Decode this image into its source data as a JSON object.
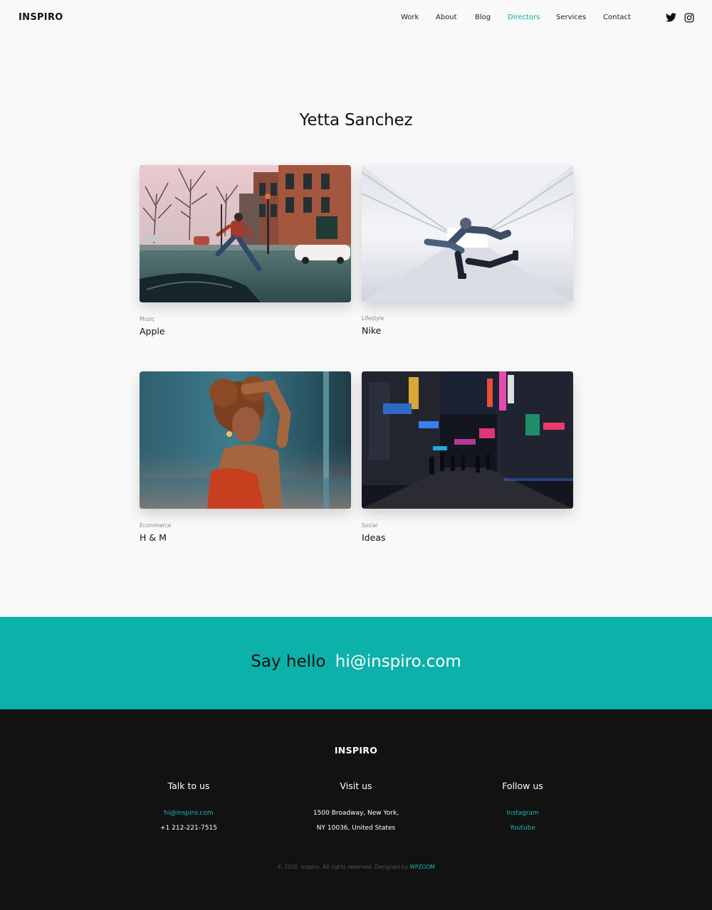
{
  "header": {
    "logo": "INSPIRO",
    "nav": [
      {
        "label": "Work",
        "active": false
      },
      {
        "label": "About",
        "active": false
      },
      {
        "label": "Blog",
        "active": false
      },
      {
        "label": "Directors",
        "active": true
      },
      {
        "label": "Services",
        "active": false
      },
      {
        "label": "Contact",
        "active": false
      }
    ],
    "social_icons": [
      "twitter-icon",
      "instagram-icon"
    ]
  },
  "main": {
    "title": "Yetta Sanchez",
    "projects": [
      {
        "category": "Music",
        "title": "Apple"
      },
      {
        "category": "Lifestyle",
        "title": "Nike"
      },
      {
        "category": "Ecommerce",
        "title": "H & M"
      },
      {
        "category": "Social",
        "title": "Ideas"
      }
    ]
  },
  "cta": {
    "prefix": "Say hello",
    "email": "hi@inspiro.com"
  },
  "footer": {
    "logo": "INSPIRO",
    "columns": [
      {
        "heading": "Talk to us",
        "lines": [
          "hi@inspiro.com",
          "+1 212-221-7515"
        ]
      },
      {
        "heading": "Visit us",
        "lines": [
          "1500 Broadway, New York,",
          "NY 10036, United States"
        ]
      },
      {
        "heading": "Follow us",
        "lines": [
          "Instagram",
          "Youtube"
        ]
      }
    ],
    "copyright": "© 2020. Inspiro. All rights reserved. Designed by",
    "designer": "WPZOOM"
  },
  "colors": {
    "accent": "#12aca5",
    "cta_band": "#0cb2a9",
    "footer_bg": "#121212",
    "page_bg": "#f9f9f9"
  }
}
